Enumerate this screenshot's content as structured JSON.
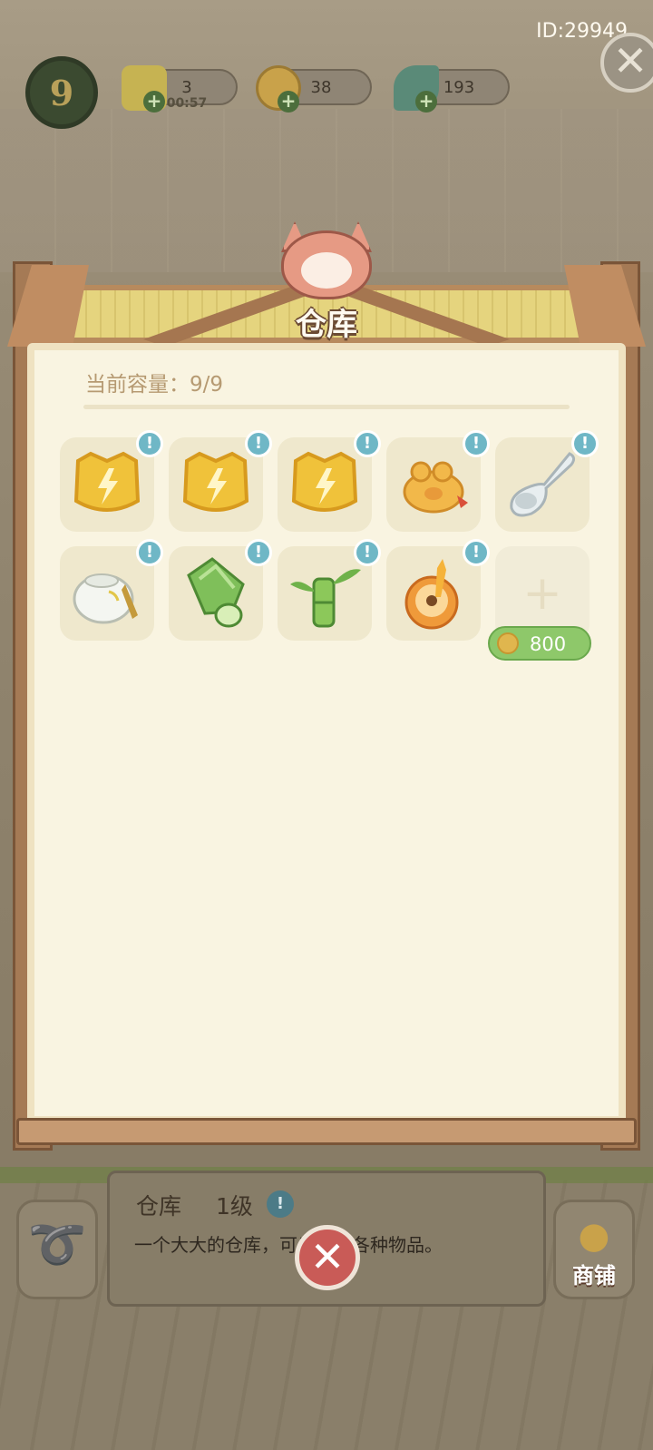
{
  "hud": {
    "level": "9",
    "energy": {
      "value": "3",
      "timer": "00:57"
    },
    "coins": {
      "value": "38"
    },
    "leaves": {
      "value": "193"
    },
    "user_id": "ID:29949"
  },
  "panel": {
    "title": "仓库",
    "capacity_label": "当前容量：9/9",
    "slots": [
      {
        "item": "energy-cat-token-icon",
        "badge": "!"
      },
      {
        "item": "energy-cat-token-icon",
        "badge": "!"
      },
      {
        "item": "energy-cat-token-icon",
        "badge": "!"
      },
      {
        "item": "golden-toad-icon",
        "badge": "!"
      },
      {
        "item": "porcelain-spoon-icon",
        "badge": "!"
      },
      {
        "item": "porcelain-teapot-icon",
        "badge": "!"
      },
      {
        "item": "bamboo-shoot-icon",
        "badge": "!"
      },
      {
        "item": "bamboo-stalk-icon",
        "badge": "!"
      },
      {
        "item": "half-orange-icon",
        "badge": "!"
      }
    ],
    "locked_slot": {
      "price": "800"
    }
  },
  "info": {
    "name": "仓库",
    "level": "1级",
    "description": "一个大大的仓库，可以放入各种物品。",
    "info_badge": "!"
  },
  "shop_button": {
    "label": "商铺"
  },
  "colors": {
    "badge": "#6fb7c6",
    "price_pill": "#8ec86a",
    "close_button": "#c95b57",
    "paper": "#f9f4e1"
  }
}
